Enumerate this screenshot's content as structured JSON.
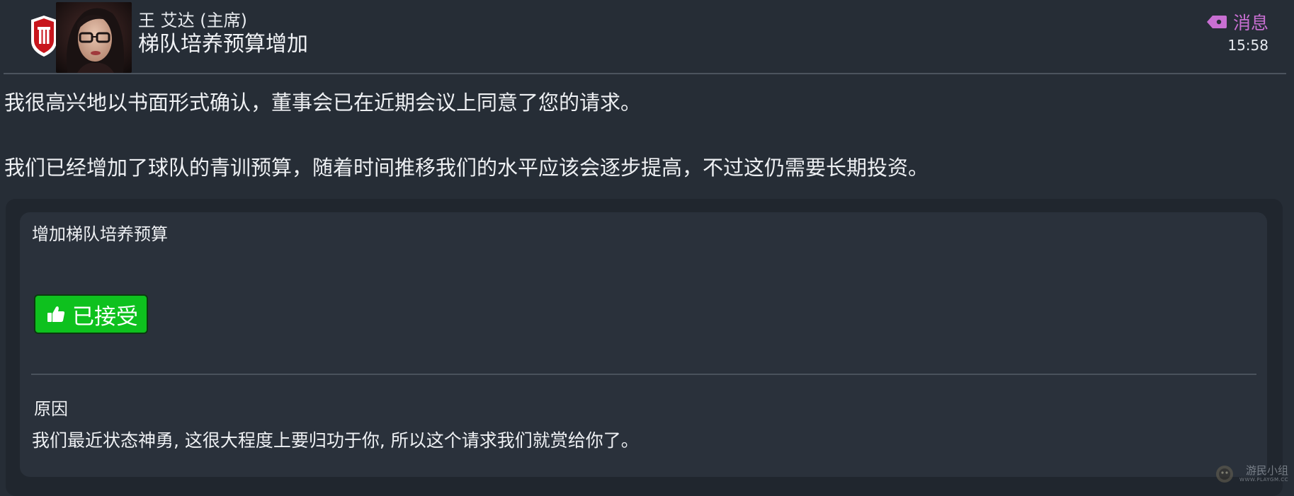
{
  "header": {
    "sender": "王 艾达 (主席)",
    "subject": "梯队培养预算增加",
    "message_type": "消息",
    "message_type_icon": "tag-icon",
    "time": "15:58"
  },
  "body": {
    "paragraphs": [
      "我很高兴地以书面形式确认，董事会已在近期会议上同意了您的请求。",
      "我们已经增加了球队的青训预算，随着时间推移我们的水平应该会逐步提高，不过这仍需要长期投资。"
    ]
  },
  "request": {
    "title": "增加梯队培养预算",
    "status_label": "已接受",
    "status_icon": "thumbs-up-icon",
    "status_color": "#0ec11e",
    "reason_label": "原因",
    "reason_text": "我们最近状态神勇, 这很大程度上要归功于你, 所以这个请求我们就赏给你了。"
  },
  "watermark": {
    "text": "游民小组",
    "url": "WWW.PLAYGM.CC"
  },
  "colors": {
    "background": "#262d36",
    "card": "#2a313b",
    "accent_message": "#c86fd2",
    "club_red": "#c8161d"
  }
}
